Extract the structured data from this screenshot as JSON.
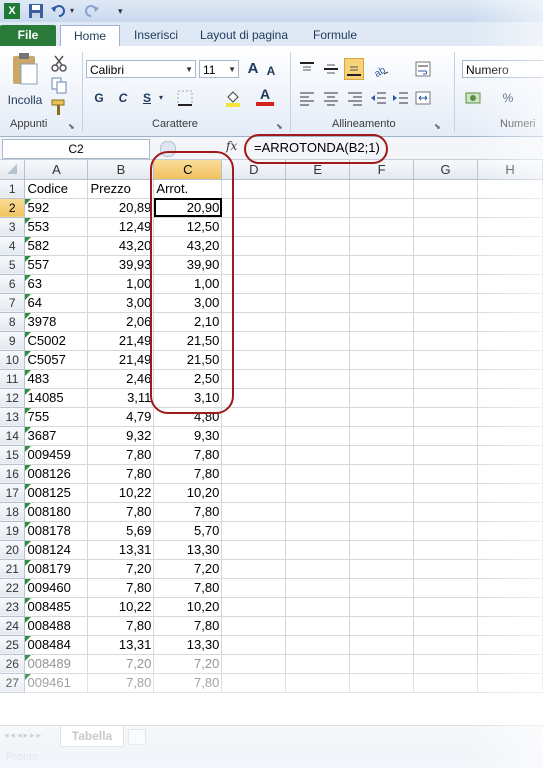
{
  "ribbon_tabs": {
    "file": "File",
    "home": "Home",
    "insert": "Inserisci",
    "layout": "Layout di pagina",
    "formulas": "Formule"
  },
  "title_text": "",
  "clipboard": {
    "paste_label": "Incolla",
    "group_label": "Appunti"
  },
  "font": {
    "name": "Calibri",
    "size": "11",
    "bold": "G",
    "italic": "C",
    "underline": "S",
    "grow": "A",
    "shrink": "A",
    "font_color": "A",
    "group_label": "Carattere"
  },
  "alignment": {
    "group_label": "Allineamento"
  },
  "number": {
    "format": "Numero",
    "percent": "%",
    "group_label": "Numeri"
  },
  "formula_bar": {
    "name_box": "C2",
    "fx": "fx",
    "formula": "=ARROTONDA(B2;1)"
  },
  "columns": [
    "A",
    "B",
    "C",
    "D",
    "E",
    "F",
    "G",
    "H"
  ],
  "rows": [
    {
      "n": "1",
      "a": "Codice",
      "b": "Prezzo",
      "c": "Arrot."
    },
    {
      "n": "2",
      "a": "592",
      "b": "20,89",
      "c": "20,90"
    },
    {
      "n": "3",
      "a": "553",
      "b": "12,49",
      "c": "12,50"
    },
    {
      "n": "4",
      "a": "582",
      "b": "43,20",
      "c": "43,20"
    },
    {
      "n": "5",
      "a": "557",
      "b": "39,93",
      "c": "39,90"
    },
    {
      "n": "6",
      "a": "63",
      "b": "1,00",
      "c": "1,00"
    },
    {
      "n": "7",
      "a": "64",
      "b": "3,00",
      "c": "3,00"
    },
    {
      "n": "8",
      "a": "3978",
      "b": "2,06",
      "c": "2,10"
    },
    {
      "n": "9",
      "a": "C5002",
      "b": "21,49",
      "c": "21,50"
    },
    {
      "n": "10",
      "a": "C5057",
      "b": "21,49",
      "c": "21,50"
    },
    {
      "n": "11",
      "a": "483",
      "b": "2,46",
      "c": "2,50"
    },
    {
      "n": "12",
      "a": "14085",
      "b": "3,11",
      "c": "3,10"
    },
    {
      "n": "13",
      "a": "755",
      "b": "4,79",
      "c": "4,80"
    },
    {
      "n": "14",
      "a": "3687",
      "b": "9,32",
      "c": "9,30"
    },
    {
      "n": "15",
      "a": "009459",
      "b": "7,80",
      "c": "7,80"
    },
    {
      "n": "16",
      "a": "008126",
      "b": "7,80",
      "c": "7,80"
    },
    {
      "n": "17",
      "a": "008125",
      "b": "10,22",
      "c": "10,20"
    },
    {
      "n": "18",
      "a": "008180",
      "b": "7,80",
      "c": "7,80"
    },
    {
      "n": "19",
      "a": "008178",
      "b": "5,69",
      "c": "5,70"
    },
    {
      "n": "20",
      "a": "008124",
      "b": "13,31",
      "c": "13,30"
    },
    {
      "n": "21",
      "a": "008179",
      "b": "7,20",
      "c": "7,20"
    },
    {
      "n": "22",
      "a": "009460",
      "b": "7,80",
      "c": "7,80"
    },
    {
      "n": "23",
      "a": "008485",
      "b": "10,22",
      "c": "10,20"
    },
    {
      "n": "24",
      "a": "008488",
      "b": "7,80",
      "c": "7,80"
    },
    {
      "n": "25",
      "a": "008484",
      "b": "13,31",
      "c": "13,30"
    },
    {
      "n": "26",
      "a": "008489",
      "b": "7,20",
      "c": "7,20"
    },
    {
      "n": "27",
      "a": "009461",
      "b": "7,80",
      "c": "7,80"
    }
  ],
  "sheet_tab": "Tabella",
  "status": "Pronto",
  "colors": {
    "file_tab": "#2a7a3a",
    "annotation": "#a11a1a",
    "selected_header": "#f1c15f",
    "number_stored_as_text": "#2f8d3e"
  }
}
